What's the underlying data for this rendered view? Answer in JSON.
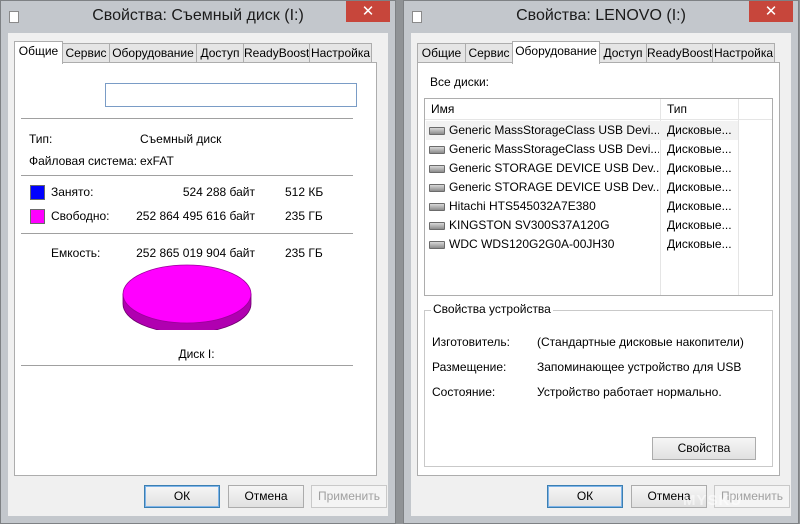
{
  "left_window": {
    "title": "Свойства: Съемный диск (I:)",
    "close_glyph": "✕",
    "tabs": [
      "Общие",
      "Сервис",
      "Оборудование",
      "Доступ",
      "ReadyBoost",
      "Настройка"
    ],
    "active_tab": "Общие",
    "label_input_value": "",
    "type_label": "Тип:",
    "type_value": "Съемный диск",
    "fs_label": "Файловая система:",
    "fs_value": "exFAT",
    "used_label": "Занято:",
    "used_bytes": "524 288 байт",
    "used_size": "512 КБ",
    "used_color": "#0000ff",
    "free_label": "Свободно:",
    "free_bytes": "252 864 495 616 байт",
    "free_size": "235 ГБ",
    "free_color": "#ff00ff",
    "capacity_label": "Емкость:",
    "capacity_bytes": "252 865 019 904 байт",
    "capacity_size": "235 ГБ",
    "disk_label": "Диск I:",
    "buttons": {
      "ok": "ОК",
      "cancel": "Отмена",
      "apply": "Применить"
    }
  },
  "right_window": {
    "title": "Свойства: LENOVO (I:)",
    "close_glyph": "✕",
    "tabs": [
      "Общие",
      "Сервис",
      "Оборудование",
      "Доступ",
      "ReadyBoost",
      "Настройка"
    ],
    "active_tab": "Оборудование",
    "all_disks_label": "Все диски:",
    "columns": {
      "name": "Имя",
      "type": "Тип"
    },
    "disks": [
      {
        "name": "Generic MassStorageClass USB Devi...",
        "type": "Дисковые..."
      },
      {
        "name": "Generic MassStorageClass USB Devi...",
        "type": "Дисковые..."
      },
      {
        "name": "Generic STORAGE DEVICE USB Dev...",
        "type": "Дисковые..."
      },
      {
        "name": "Generic STORAGE DEVICE USB Dev...",
        "type": "Дисковые..."
      },
      {
        "name": "Hitachi HTS545032A7E380",
        "type": "Дисковые..."
      },
      {
        "name": "KINGSTON SV300S37A120G",
        "type": "Дисковые..."
      },
      {
        "name": "WDC WDS120G2G0A-00JH30",
        "type": "Дисковые..."
      }
    ],
    "device_props_label": "Свойства устройства",
    "manufacturer_label": "Изготовитель:",
    "manufacturer_value": "(Стандартные дисковые накопители)",
    "location_label": "Размещение:",
    "location_value": "Запоминающее устройство для USB",
    "status_label": "Состояние:",
    "status_value": "Устройство работает нормально.",
    "properties_button": "Свойства",
    "buttons": {
      "ok": "ОК",
      "cancel": "Отмена",
      "apply": "Применить"
    }
  },
  "watermark": "MYSKU"
}
